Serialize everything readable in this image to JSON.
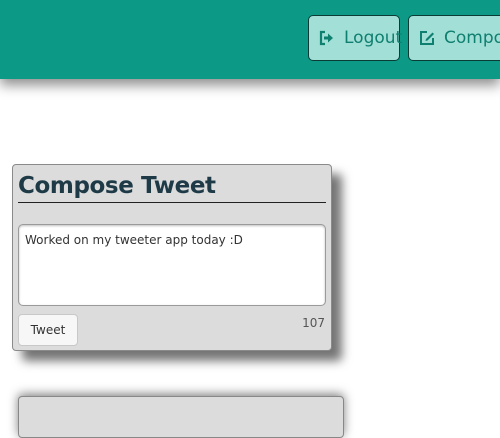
{
  "nav": {
    "logout": {
      "label": "Logout",
      "icon": "sign-out-icon"
    },
    "compose": {
      "label": "Compose",
      "icon": "edit-icon"
    },
    "colors": {
      "bar": "#0c9a86",
      "button_bg": "#a2dfd6",
      "button_text": "#0f7f70"
    }
  },
  "compose": {
    "title": "Compose Tweet",
    "text_value": "Worked on my tweeter app today :D",
    "submit_label": "Tweet",
    "char_count": "107"
  }
}
